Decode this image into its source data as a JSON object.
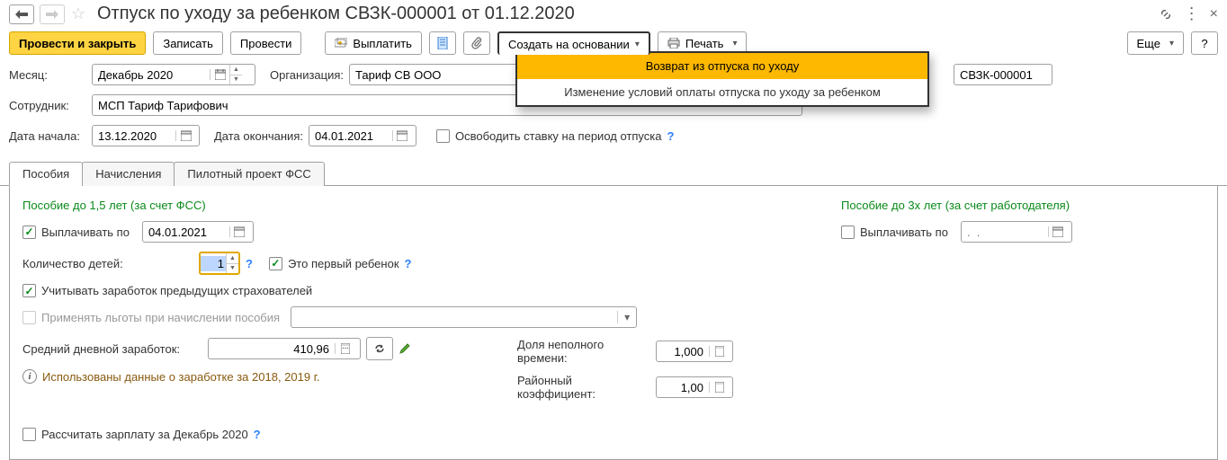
{
  "header": {
    "title": "Отпуск по уходу за ребенком СВЗК-000001 от 01.12.2020"
  },
  "toolbar": {
    "post_close": "Провести и закрыть",
    "save": "Записать",
    "post": "Провести",
    "pay": "Выплатить",
    "create_based": "Создать на основании",
    "print": "Печать",
    "more": "Еще",
    "help": "?"
  },
  "dropdown": {
    "item1": "Возврат из отпуска по уходу",
    "item2": "Изменение условий оплаты отпуска по уходу за ребенком"
  },
  "fields": {
    "month_label": "Месяц:",
    "month_value": "Декабрь 2020",
    "org_label": "Организация:",
    "org_value": "Тариф СВ ООО",
    "number_value": "СВЗК-000001",
    "employee_label": "Сотрудник:",
    "employee_value": "МСП Тариф Тарифович",
    "start_date_label": "Дата начала:",
    "start_date_value": "13.12.2020",
    "end_date_label": "Дата окончания:",
    "end_date_value": "04.01.2021",
    "free_position_label": "Освободить ставку на период отпуска"
  },
  "tabs": {
    "benefits": "Пособия",
    "accruals": "Начисления",
    "pilot": "Пилотный проект ФСС"
  },
  "benefits": {
    "section1_title": "Пособие до 1,5 лет (за счет ФСС)",
    "pay_until_label": "Выплачивать по",
    "pay_until_value": "04.01.2021",
    "children_count_label": "Количество детей:",
    "children_count_value": "1",
    "first_child_label": "Это первый ребенок",
    "prev_insurers_label": "Учитывать заработок предыдущих страхователей",
    "apply_benefits_label": "Применять льготы при начислении пособия",
    "avg_daily_label": "Средний дневной заработок:",
    "avg_daily_value": "410,96",
    "info_text": "Использованы данные о заработке за  2018,  2019 г.",
    "partial_label": "Доля неполного времени:",
    "partial_value": "1,000",
    "district_label": "Районный коэффициент:",
    "district_value": "1,00",
    "section2_title": "Пособие до 3х лет (за счет работодателя)",
    "pay_until2_label": "Выплачивать по",
    "pay_until2_placeholder": ".  .",
    "calc_salary_label": "Рассчитать зарплату за Декабрь 2020"
  }
}
